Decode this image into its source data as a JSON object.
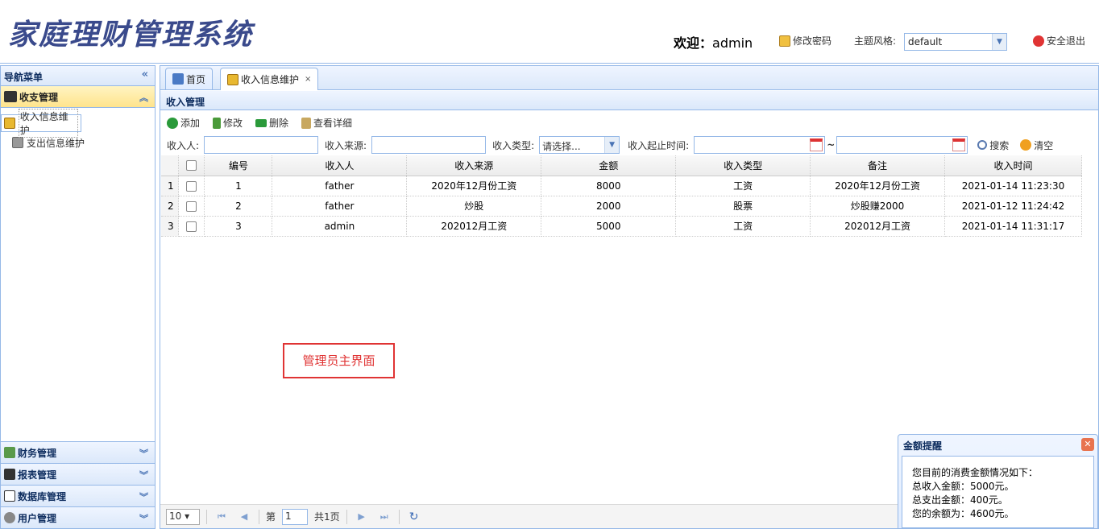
{
  "header": {
    "title": "家庭理财管理系统",
    "welcome_label": "欢迎：",
    "user": "admin",
    "change_pwd": "修改密码",
    "theme_label": "主题风格:",
    "theme_value": "default",
    "logout": "安全退出"
  },
  "sidebar": {
    "title": "导航菜单",
    "sections": [
      {
        "label": "收支管理",
        "items": [
          "收入信息维护",
          "支出信息维护"
        ]
      },
      {
        "label": "财务管理"
      },
      {
        "label": "报表管理"
      },
      {
        "label": "数据库管理"
      },
      {
        "label": "用户管理"
      }
    ]
  },
  "tabs": [
    {
      "label": "首页"
    },
    {
      "label": "收入信息维护"
    }
  ],
  "panel": {
    "title": "收入管理"
  },
  "toolbar": {
    "add": "添加",
    "edit": "修改",
    "delete": "删除",
    "view": "查看详细"
  },
  "search": {
    "payer": "收入人:",
    "source": "收入来源:",
    "type": "收入类型:",
    "type_value": "请选择...",
    "time": "收入起止时间:",
    "tilde": "~",
    "search_btn": "搜索",
    "clear_btn": "清空"
  },
  "table": {
    "headers": [
      "编号",
      "收入人",
      "收入来源",
      "金额",
      "收入类型",
      "备注",
      "收入时间"
    ],
    "rows": [
      [
        "1",
        "1",
        "father",
        "2020年12月份工资",
        "8000",
        "工资",
        "2020年12月份工资",
        "2021-01-14 11:23:30"
      ],
      [
        "2",
        "2",
        "father",
        "炒股",
        "2000",
        "股票",
        "炒股赚2000",
        "2021-01-12 11:24:42"
      ],
      [
        "3",
        "3",
        "admin",
        "202012月工资",
        "5000",
        "工资",
        "202012月工资",
        "2021-01-14 11:31:17"
      ]
    ]
  },
  "callout": "管理员主界面",
  "pager": {
    "page_size": "10",
    "page_prefix": "第",
    "page_value": "1",
    "page_total": "共1页"
  },
  "popup": {
    "title": "金额提醒",
    "lines": [
      "您目前的消费金额情况如下：",
      "总收入金额：5000元。",
      "总支出金额：400元。",
      "您的余额为：4600元。"
    ]
  }
}
